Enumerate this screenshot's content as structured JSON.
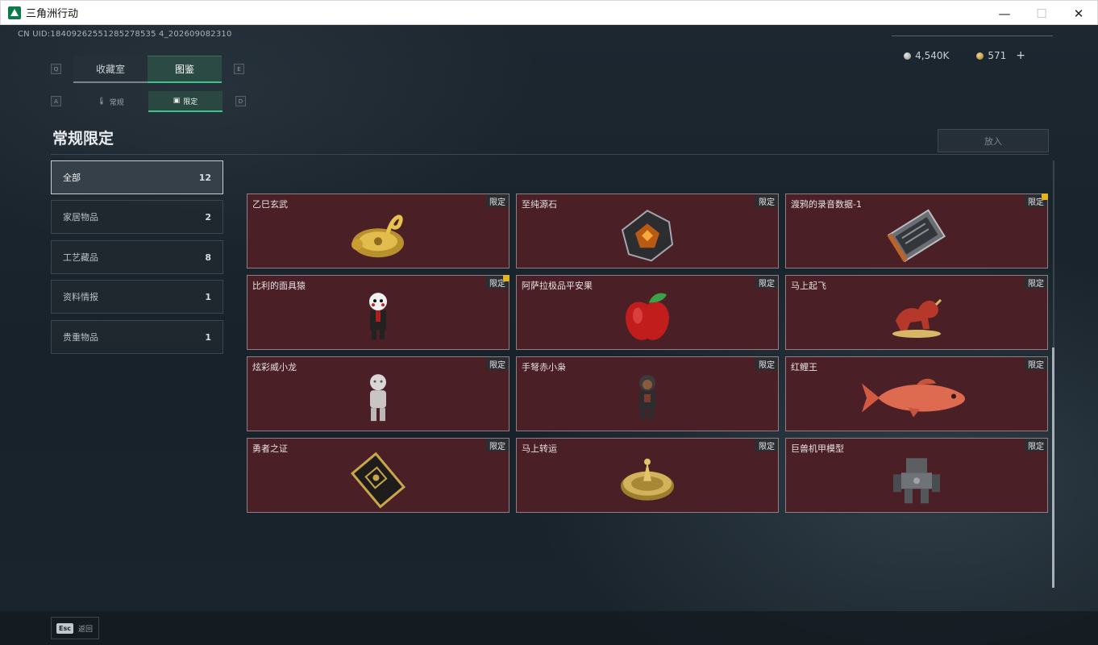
{
  "window": {
    "title": "三角洲行动"
  },
  "header": {
    "uid": "CN UID:18409262551285278535 4_202609082310",
    "currency": [
      {
        "name": "silver",
        "value": "4,540K"
      },
      {
        "name": "gold",
        "value": "571"
      }
    ],
    "add_label": "+"
  },
  "tabs": {
    "top": [
      {
        "label": "收藏室",
        "active": false
      },
      {
        "label": "图鉴",
        "active": true
      }
    ],
    "top_hint_left": "Q",
    "top_hint_right": "E",
    "sub": [
      {
        "label": "常规",
        "active": false
      },
      {
        "label": "限定",
        "active": true
      }
    ],
    "sub_hint_left": "A",
    "sub_hint_right": "D"
  },
  "main": {
    "title": "常规限定",
    "put_button": "放入"
  },
  "sidebar": {
    "items": [
      {
        "label": "全部",
        "count": "12",
        "active": true
      },
      {
        "label": "家居物品",
        "count": "2",
        "active": false
      },
      {
        "label": "工艺藏品",
        "count": "8",
        "active": false
      },
      {
        "label": "资料情报",
        "count": "1",
        "active": false
      },
      {
        "label": "贵重物品",
        "count": "1",
        "active": false
      }
    ]
  },
  "items": [
    {
      "name": "乙巳玄武",
      "badge": "限定",
      "warn": false,
      "icon": "golden-snake-turtle-icon"
    },
    {
      "name": "至纯源石",
      "badge": "限定",
      "warn": false,
      "icon": "source-stone-icon"
    },
    {
      "name": "渡鸦的录音数据-1",
      "badge": "限定",
      "warn": true,
      "icon": "recording-device-icon"
    },
    {
      "name": "比利的面具猿",
      "badge": "限定",
      "warn": true,
      "icon": "puppet-figure-icon"
    },
    {
      "name": "阿萨拉极品平安果",
      "badge": "限定",
      "warn": false,
      "icon": "red-apple-icon"
    },
    {
      "name": "马上起飞",
      "badge": "限定",
      "warn": false,
      "icon": "red-horse-statue-icon"
    },
    {
      "name": "炫彩威小龙",
      "badge": "限定",
      "warn": false,
      "icon": "white-figure-icon"
    },
    {
      "name": "手弩赤小枭",
      "badge": "限定",
      "warn": false,
      "icon": "hooded-figure-icon"
    },
    {
      "name": "红鲤王",
      "badge": "限定",
      "warn": false,
      "icon": "red-carp-icon"
    },
    {
      "name": "勇者之证",
      "badge": "限定",
      "warn": false,
      "icon": "card-plaque-icon"
    },
    {
      "name": "马上转运",
      "badge": "限定",
      "warn": false,
      "icon": "golden-wheel-icon"
    },
    {
      "name": "巨兽机甲模型",
      "badge": "限定",
      "warn": false,
      "icon": "mech-model-icon"
    }
  ],
  "footer": {
    "esc_key": "Esc",
    "back_label": "返回"
  }
}
